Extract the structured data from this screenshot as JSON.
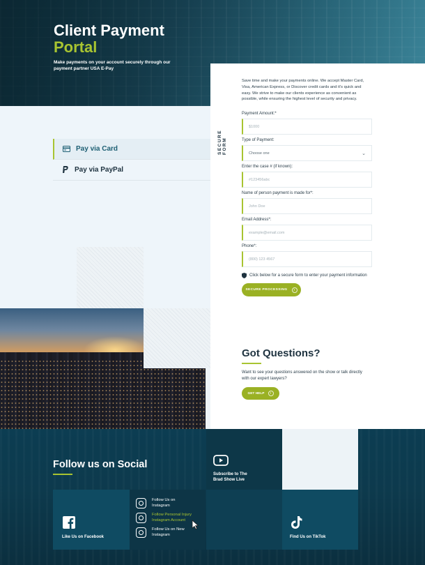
{
  "hero": {
    "title_line1": "Client Payment",
    "title_line2": "Portal",
    "subtitle": "Make payments on your account securely through our payment partner USA E-Pay"
  },
  "tabs": [
    {
      "label": "Pay via Card",
      "icon": "credit-card-icon",
      "active": true
    },
    {
      "label": "Pay via PayPal",
      "icon": "paypal-icon",
      "active": false
    }
  ],
  "form": {
    "side_label": "SECURE FORM",
    "intro": "Save time and make your payments online. We accept Master Card, Visa, American Express, or Discover credit cards and it's quick and easy. We strive to make our clients experience as convenient as possible, while ensuring the highest level of security and privacy.",
    "fields": [
      {
        "label": "Payment Amount:*",
        "placeholder": "$1000"
      },
      {
        "label": "Type of Payment:",
        "placeholder": "Choose one"
      },
      {
        "label": "Enter the case # (if known):",
        "placeholder": "#123456abc"
      },
      {
        "label": "Name of person payment is made for*:",
        "placeholder": "John Doe"
      },
      {
        "label": "Email Address*:",
        "placeholder": "example@email.com"
      },
      {
        "label": "Phone*:",
        "placeholder": "(800) 123 4567"
      }
    ],
    "notice": "Click below for a secure form to enter your payment information",
    "submit": "SECURE PROCESSING"
  },
  "questions": {
    "title": "Got Questions?",
    "text": "Want to see your questions answered on the show or talk directly with our expert lawyers?",
    "button": "GET HELP"
  },
  "social": {
    "heading": "Follow us on Social",
    "facebook": "Like Us on Facebook",
    "instagram": [
      {
        "label": "Follow Us on Instagram"
      },
      {
        "label": "Follow Personal Injury Instagram Account"
      },
      {
        "label": "Follow Us on New Instagram"
      }
    ],
    "youtube": "Subscribe to The Brad Show Live",
    "tiktok": "Find Us on TikTok"
  },
  "colors": {
    "accent": "#a8c431",
    "button": "#9ab124",
    "dark": "#0c3d52"
  }
}
